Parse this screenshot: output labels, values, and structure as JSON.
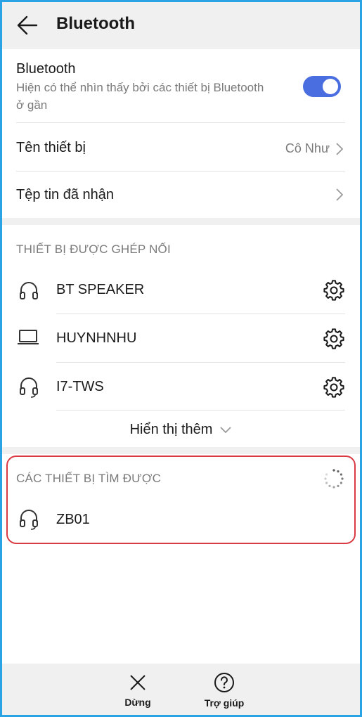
{
  "header": {
    "title": "Bluetooth",
    "back_icon": "arrow-left-icon"
  },
  "bluetooth": {
    "title": "Bluetooth",
    "subtitle_line1": "Hiện có thể nhìn thấy bởi các thiết bị Bluetooth",
    "subtitle_line2": "ở gần",
    "enabled": true,
    "toggle_color": "#4a6ee0"
  },
  "device_name": {
    "label": "Tên thiết bị",
    "value": "Cô Như"
  },
  "received_files": {
    "label": "Tệp tin đã nhận"
  },
  "paired": {
    "header": "THIẾT BỊ ĐƯỢC GHÉP NỐI",
    "devices": [
      {
        "name": "BT SPEAKER",
        "icon": "headphones-icon"
      },
      {
        "name": "HUYNHNHU",
        "icon": "laptop-icon"
      },
      {
        "name": "I7-TWS",
        "icon": "headphones-icon"
      }
    ],
    "show_more": "Hiển thị thêm"
  },
  "available": {
    "header": "CÁC THIẾT BỊ TÌM ĐƯỢC",
    "devices": [
      {
        "name": "ZB01",
        "icon": "headphones-icon"
      }
    ],
    "highlight_color": "#d93a43"
  },
  "bottom_bar": {
    "stop_label": "Dừng",
    "help_label": "Trợ giúp"
  }
}
